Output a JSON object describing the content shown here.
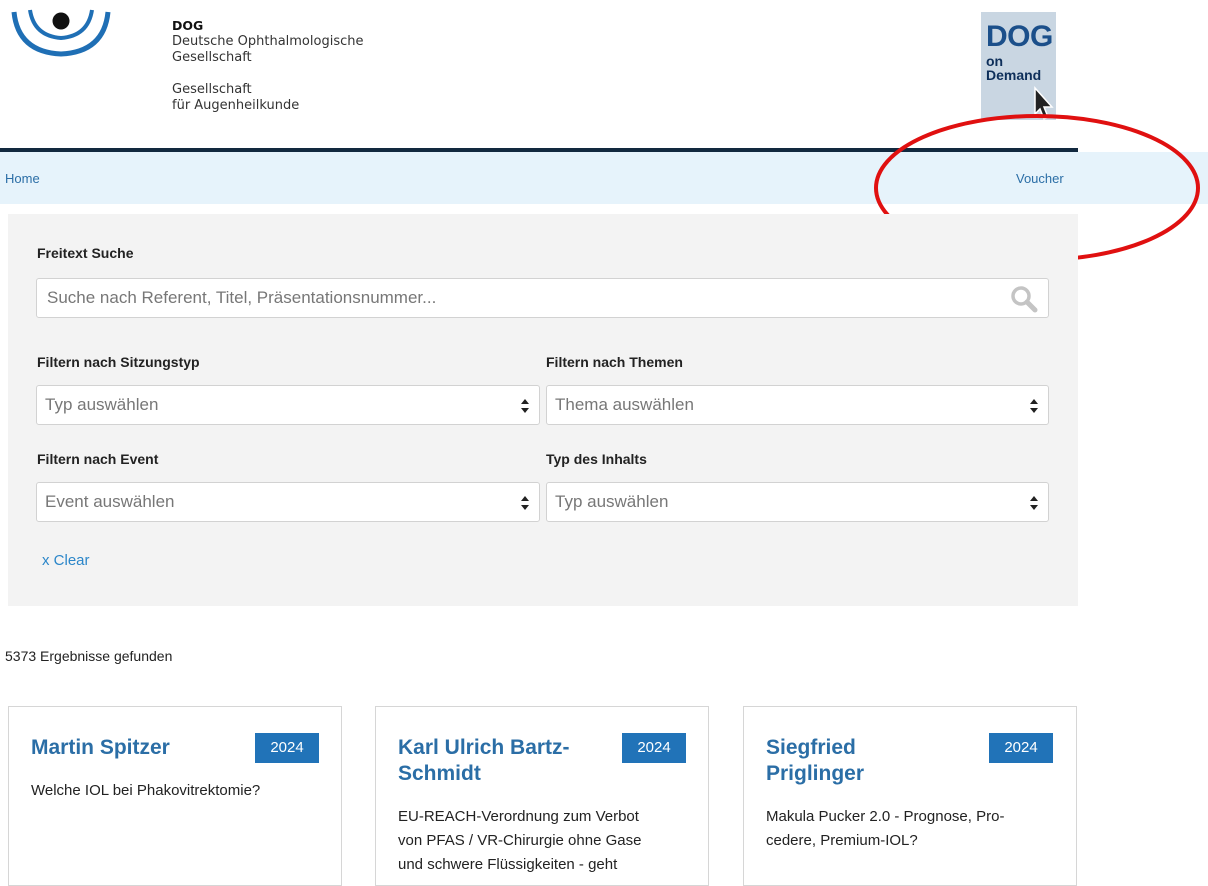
{
  "header": {
    "org_abbr": "DOG",
    "org_name_1": "Deutsche Ophthalmologische",
    "org_name_2": "Gesellschaft",
    "org_sub_1": "Gesellschaft",
    "org_sub_2": "für Augenheilkunde",
    "dod_logo": {
      "big": "DOG",
      "line2": "on",
      "line3": "Demand"
    }
  },
  "nav": {
    "home": "Home",
    "voucher": "Voucher"
  },
  "filters": {
    "freitext_label": "Freitext Suche",
    "search_placeholder": "Suche nach Referent, Titel, Präsentationsnummer...",
    "sitzungstyp_label": "Filtern nach Sitzungstyp",
    "sitzungstyp_value": "Typ auswählen",
    "themen_label": "Filtern nach Themen",
    "themen_value": "Thema auswählen",
    "event_label": "Filtern nach Event",
    "event_value": "Event auswählen",
    "inhalt_label": "Typ des Inhalts",
    "inhalt_value": "Typ auswählen",
    "clear": "x Clear"
  },
  "results_count": "5373 Ergebnisse gefunden",
  "cards": [
    {
      "name": "Martin Spitzer",
      "year": "2024",
      "title": "Welche IOL bei Phakovitrektomie?"
    },
    {
      "name_1": "Karl Ulrich Bartz-",
      "name_2": "Schmidt",
      "year": "2024",
      "title_1": "EU-REACH-Verordnung zum Verbot",
      "title_2": "von PFAS / VR-Chirurgie ohne Gase",
      "title_3": "und schwere Flüssigkeiten - geht"
    },
    {
      "name_1": "Siegfried",
      "name_2": "Priglinger",
      "year": "2024",
      "title_1": "Makula Pucker 2.0 - Prognose, Pro-",
      "title_2": "cedere, Premium-IOL?"
    }
  ],
  "colors": {
    "brand_blue": "#2173b8",
    "link": "#2b6ea6",
    "nav_bg": "#e6f3fb",
    "annotation": "#e01010"
  },
  "icons": [
    "eye-logo-icon",
    "search-icon",
    "select-arrows-icon",
    "cursor-icon"
  ]
}
